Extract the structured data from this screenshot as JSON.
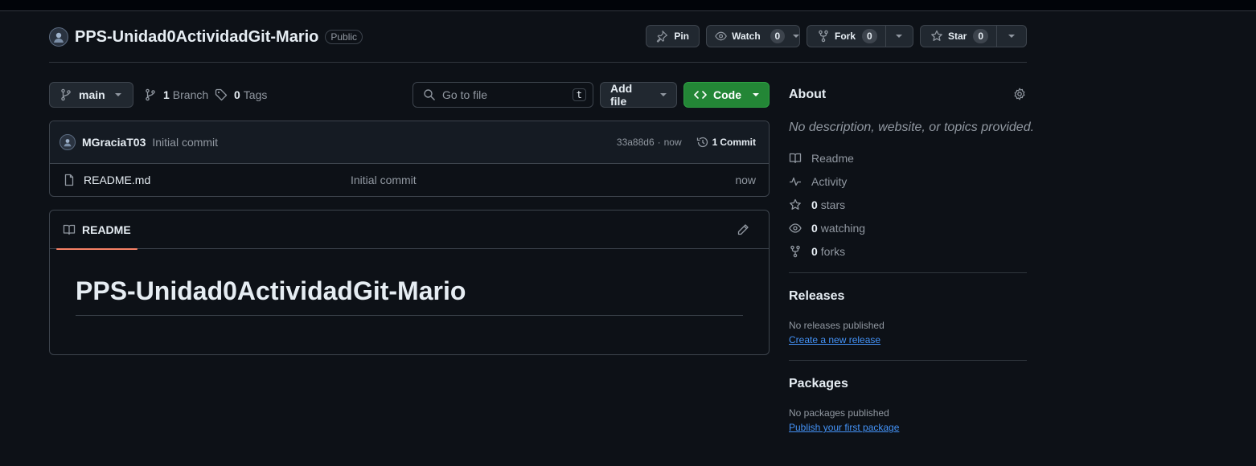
{
  "repo": {
    "name": "PPS-Unidad0ActividadGit-Mario",
    "visibility": "Public"
  },
  "actions": {
    "pin": "Pin",
    "watch": "Watch",
    "watch_count": "0",
    "fork": "Fork",
    "fork_count": "0",
    "star": "Star",
    "star_count": "0"
  },
  "toolbar": {
    "branch": "main",
    "branches_count": "1",
    "branches_label": "Branch",
    "tags_count": "0",
    "tags_label": "Tags",
    "search_placeholder": "Go to file",
    "search_shortcut": "t",
    "add_file": "Add file",
    "code": "Code"
  },
  "commit": {
    "author": "MGraciaT03",
    "message": "Initial commit",
    "hash": "33a88d6",
    "time": "now",
    "commits_count": "1",
    "commits_label": "Commit"
  },
  "files": [
    {
      "name": "README.md",
      "message": "Initial commit",
      "time": "now"
    }
  ],
  "readme": {
    "tab": "README",
    "heading": "PPS-Unidad0ActividadGit-Mario"
  },
  "about": {
    "title": "About",
    "description": "No description, website, or topics provided.",
    "readme": "Readme",
    "activity": "Activity",
    "stars_count": "0",
    "stars_label": "stars",
    "watching_count": "0",
    "watching_label": "watching",
    "forks_count": "0",
    "forks_label": "forks"
  },
  "releases": {
    "title": "Releases",
    "empty": "No releases published",
    "link": "Create a new release"
  },
  "packages": {
    "title": "Packages",
    "empty": "No packages published",
    "link": "Publish your first package"
  },
  "colors": {
    "accent_green": "#238636",
    "link_blue": "#4493f8",
    "tab_underline": "#f78166"
  }
}
